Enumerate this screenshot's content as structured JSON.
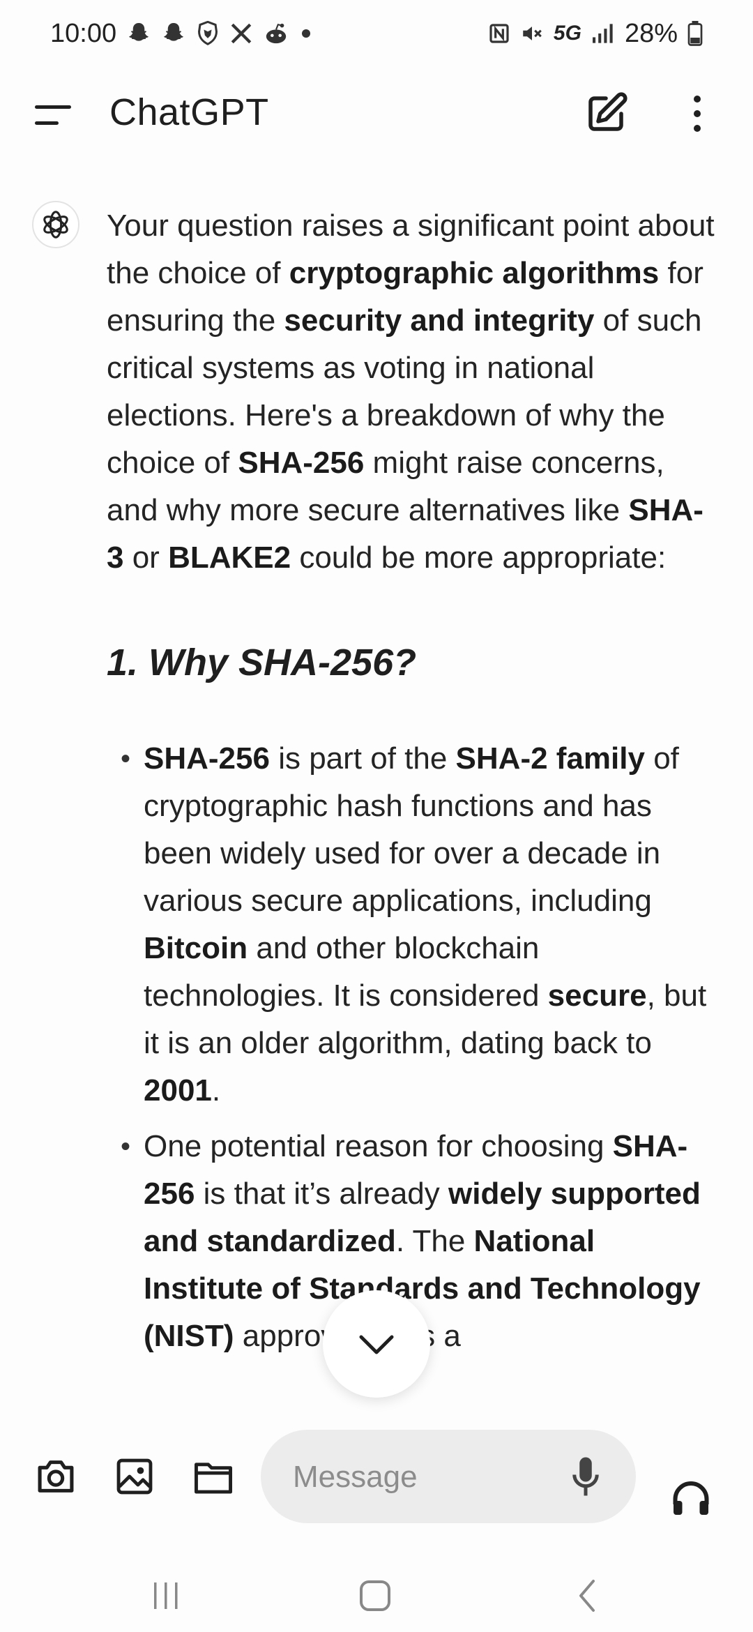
{
  "status_bar": {
    "time": "10:00",
    "battery": "28%",
    "network": "5G",
    "left_icons": [
      "snapchat-icon",
      "snapchat-icon",
      "brave-icon",
      "x-icon",
      "reddit-icon",
      "dot-icon"
    ],
    "right_icons": [
      "nfc-icon",
      "mute-icon",
      "5g-icon",
      "signal-icon",
      "battery-icon"
    ]
  },
  "app_bar": {
    "title": "ChatGPT"
  },
  "message": {
    "intro": {
      "t1": "Your question raises a significant point about the choice of ",
      "b1": "cryptographic algorithms",
      "t2": " for ensuring the ",
      "b2": "security and integrity",
      "t3": " of such critical systems as voting in national elections. Here's a breakdown of why the choice of ",
      "b3": "SHA-256",
      "t4": " might raise concerns, and why more secure alternatives like ",
      "b4": "SHA-3",
      "t5": " or ",
      "b5": "BLAKE2",
      "t6": " could be more appropriate:"
    },
    "heading": "1. Why SHA-256?",
    "bullet1": {
      "b1": "SHA-256",
      "t1": " is part of the ",
      "b2": "SHA-2 family",
      "t2": " of cryptographic hash functions and has been widely used for over a decade in various secure applications, including ",
      "b3": "Bitcoin",
      "t3": " and other blockchain technologies. It is considered ",
      "b4": "secure",
      "t4": ", but it is an older algorithm, dating back to ",
      "b5": "2001",
      "t5": "."
    },
    "bullet2": {
      "t1": "One potential reason for choosing ",
      "b1": "SHA-256",
      "t2": " is that it’s already ",
      "b2": "widely supported and standardized",
      "t3": ". The ",
      "b3": "National Institute of Standards and Technology (NIST)",
      "t4": " approved it as a"
    }
  },
  "composer": {
    "placeholder": "Message",
    "tools": [
      "camera-icon",
      "image-icon",
      "folder-icon"
    ]
  },
  "colors": {
    "background": "#fdfdfd",
    "text": "#242424",
    "input_background": "#ececec"
  }
}
